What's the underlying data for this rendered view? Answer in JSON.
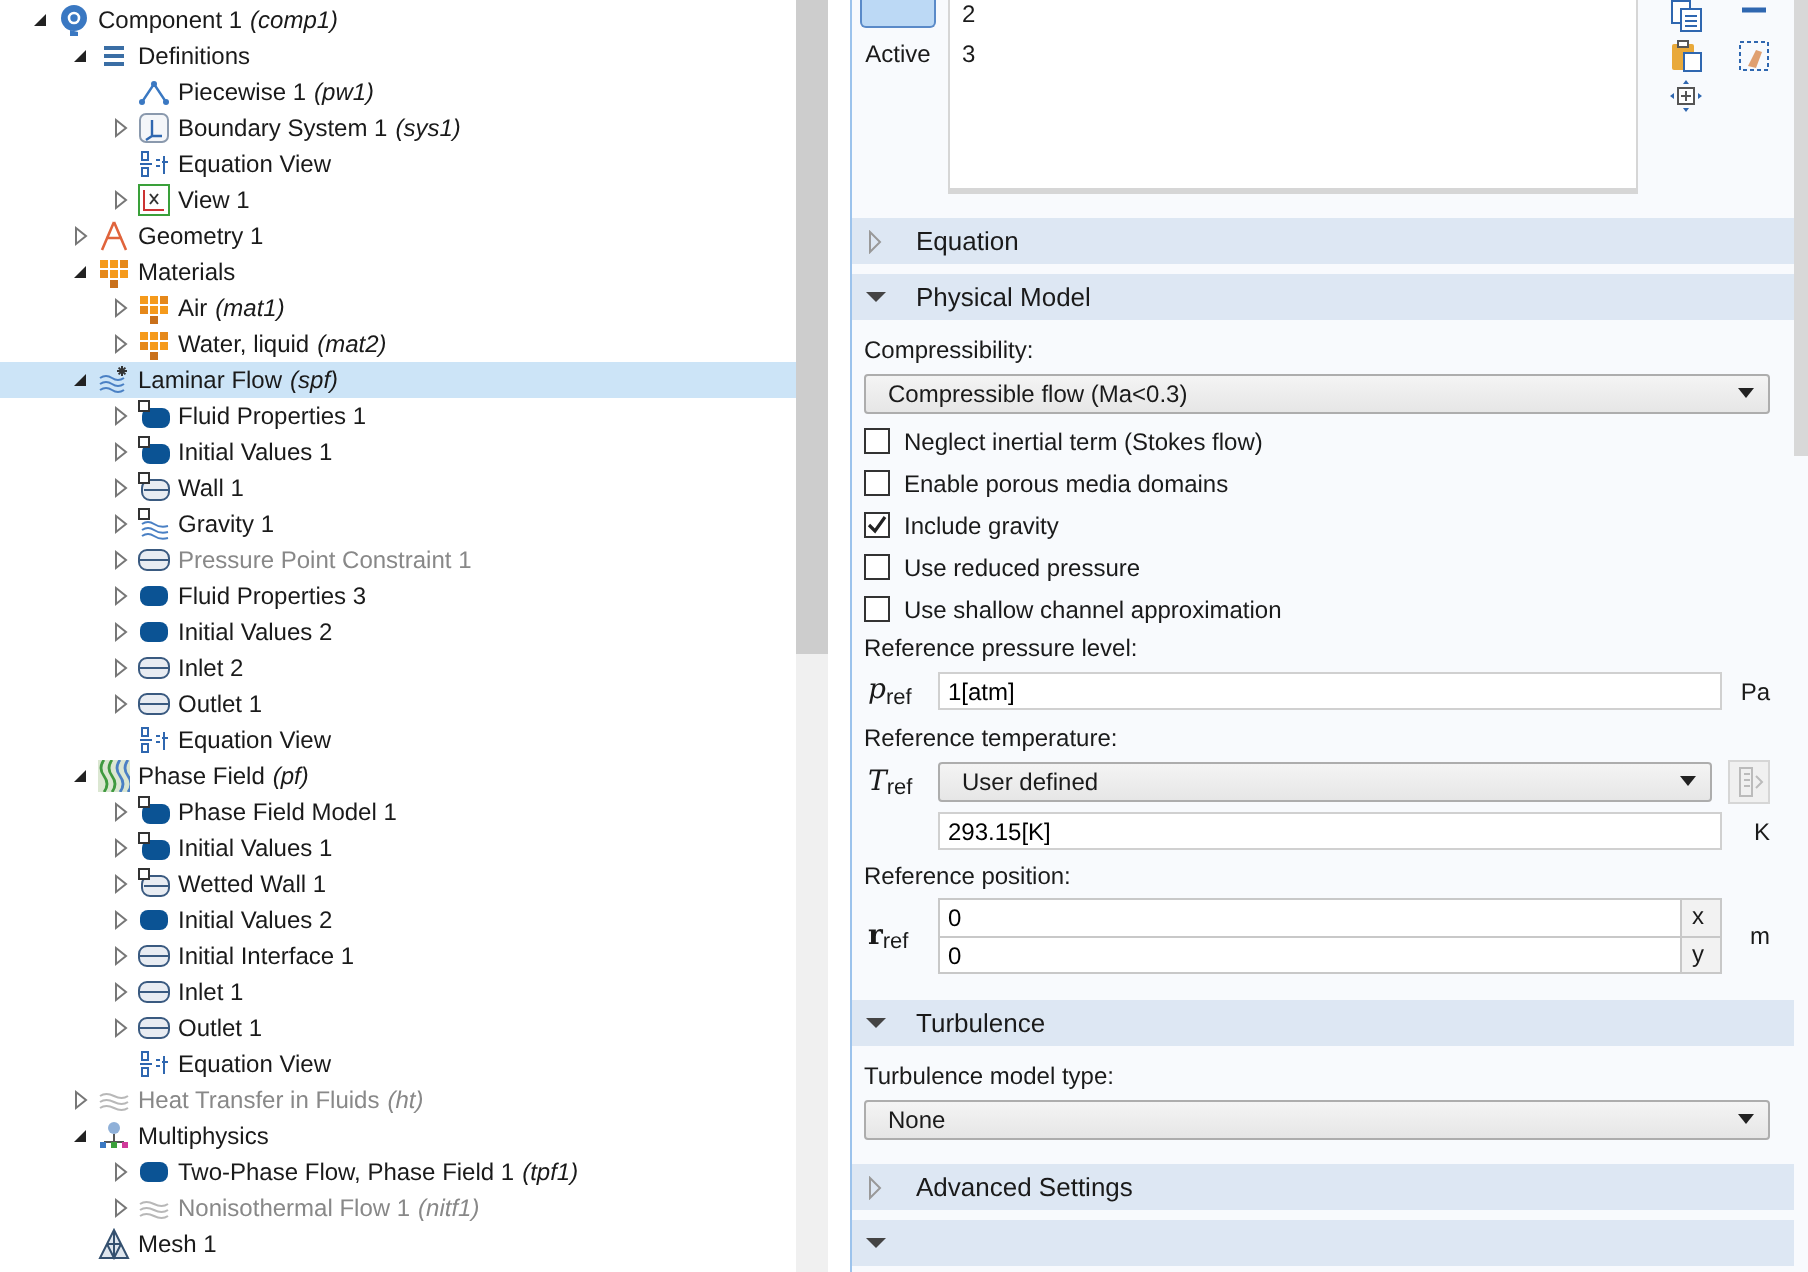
{
  "tree": [
    {
      "label": "Component 1",
      "tag": "(comp1)",
      "kind": "component",
      "expanded": true,
      "selected": false,
      "disabled": false,
      "children": [
        {
          "label": "Definitions",
          "kind": "list",
          "expanded": true,
          "selected": false,
          "disabled": false,
          "children": [
            {
              "label": "Piecewise 1",
              "tag": "(pw1)",
              "kind": "piecewise",
              "selected": false,
              "disabled": false
            },
            {
              "label": "Boundary System 1",
              "tag": "(sys1)",
              "kind": "coordsys",
              "expanded": false,
              "selected": false,
              "disabled": false
            },
            {
              "label": "Equation View",
              "kind": "equation",
              "selected": false,
              "disabled": false
            },
            {
              "label": "View 1",
              "kind": "view",
              "expanded": false,
              "selected": false,
              "disabled": false
            }
          ]
        },
        {
          "label": "Geometry 1",
          "kind": "geometry",
          "expanded": false,
          "selected": false,
          "disabled": false
        },
        {
          "label": "Materials",
          "kind": "materials",
          "expanded": true,
          "selected": false,
          "disabled": false,
          "children": [
            {
              "label": "Air",
              "tag": "(mat1)",
              "kind": "materials",
              "expanded": false,
              "selected": false,
              "disabled": false
            },
            {
              "label": "Water, liquid",
              "tag": "(mat2)",
              "kind": "materials",
              "expanded": false,
              "selected": false,
              "disabled": false
            }
          ]
        },
        {
          "label": "Laminar Flow",
          "tag": "(spf)",
          "kind": "flow",
          "expanded": true,
          "selected": true,
          "disabled": false,
          "children": [
            {
              "label": "Fluid Properties 1",
              "kind": "domain-default",
              "expanded": false,
              "selected": false,
              "disabled": false
            },
            {
              "label": "Initial Values 1",
              "kind": "domain-default",
              "expanded": false,
              "selected": false,
              "disabled": false
            },
            {
              "label": "Wall 1",
              "kind": "boundary-default",
              "expanded": false,
              "selected": false,
              "disabled": false
            },
            {
              "label": "Gravity 1",
              "kind": "gravity",
              "expanded": false,
              "selected": false,
              "disabled": false
            },
            {
              "label": "Pressure Point Constraint 1",
              "kind": "boundary",
              "expanded": false,
              "selected": false,
              "disabled": true
            },
            {
              "label": "Fluid Properties 3",
              "kind": "domain",
              "expanded": false,
              "selected": false,
              "disabled": false
            },
            {
              "label": "Initial Values 2",
              "kind": "domain",
              "expanded": false,
              "selected": false,
              "disabled": false
            },
            {
              "label": "Inlet 2",
              "kind": "boundary",
              "expanded": false,
              "selected": false,
              "disabled": false
            },
            {
              "label": "Outlet 1",
              "kind": "boundary",
              "expanded": false,
              "selected": false,
              "disabled": false
            },
            {
              "label": "Equation View",
              "kind": "equation",
              "selected": false,
              "disabled": false
            }
          ]
        },
        {
          "label": "Phase Field",
          "tag": "(pf)",
          "kind": "phase",
          "expanded": true,
          "selected": false,
          "disabled": false,
          "children": [
            {
              "label": "Phase Field Model 1",
              "kind": "domain-default",
              "expanded": false,
              "selected": false,
              "disabled": false
            },
            {
              "label": "Initial Values 1",
              "kind": "domain-default",
              "expanded": false,
              "selected": false,
              "disabled": false
            },
            {
              "label": "Wetted Wall 1",
              "kind": "boundary-default",
              "expanded": false,
              "selected": false,
              "disabled": false
            },
            {
              "label": "Initial Values 2",
              "kind": "domain",
              "expanded": false,
              "selected": false,
              "disabled": false
            },
            {
              "label": "Initial Interface 1",
              "kind": "boundary",
              "expanded": false,
              "selected": false,
              "disabled": false
            },
            {
              "label": "Inlet 1",
              "kind": "boundary",
              "expanded": false,
              "selected": false,
              "disabled": false
            },
            {
              "label": "Outlet 1",
              "kind": "boundary",
              "expanded": false,
              "selected": false,
              "disabled": false
            },
            {
              "label": "Equation View",
              "kind": "equation",
              "selected": false,
              "disabled": false
            }
          ]
        },
        {
          "label": "Heat Transfer in Fluids",
          "tag": "(ht)",
          "kind": "heat",
          "expanded": false,
          "selected": false,
          "disabled": true
        },
        {
          "label": "Multiphysics",
          "kind": "multiphysics",
          "expanded": true,
          "selected": false,
          "disabled": false,
          "children": [
            {
              "label": "Two-Phase Flow, Phase Field 1",
              "tag": "(tpf1)",
              "kind": "domain",
              "expanded": false,
              "selected": false,
              "disabled": false
            },
            {
              "label": "Nonisothermal Flow 1",
              "tag": "(nitf1)",
              "kind": "heat",
              "expanded": false,
              "selected": false,
              "disabled": true
            }
          ]
        },
        {
          "label": "Mesh 1",
          "kind": "mesh",
          "selected": false,
          "disabled": false
        }
      ]
    }
  ],
  "selection": {
    "button": "Active",
    "items": [
      "2",
      "3"
    ]
  },
  "sections": [
    {
      "title": "Equation",
      "expanded": false
    },
    {
      "title": "Physical Model",
      "expanded": true,
      "controls": [
        {
          "kind": "label",
          "text": "Compressibility:"
        },
        {
          "kind": "select",
          "value": "Compressible flow (Ma<0.3)"
        },
        {
          "kind": "checkbox",
          "label": "Neglect inertial term (Stokes flow)",
          "checked": false
        },
        {
          "kind": "checkbox",
          "label": "Enable porous media domains",
          "checked": false
        },
        {
          "kind": "checkbox",
          "label": "Include gravity",
          "checked": true
        },
        {
          "kind": "checkbox",
          "label": "Use reduced pressure",
          "checked": false
        },
        {
          "kind": "checkbox",
          "label": "Use shallow channel approximation",
          "checked": false
        },
        {
          "kind": "label",
          "text": "Reference pressure level:"
        },
        {
          "kind": "input",
          "symbol": "*p*$_{ref}$",
          "value": "1[atm]",
          "unit": "Pa"
        },
        {
          "kind": "label",
          "text": "Reference temperature:"
        },
        {
          "kind": "select",
          "symbol": "*T*$_{ref}$",
          "value": "User defined",
          "side_button": true
        },
        {
          "kind": "input",
          "value": "293.15[K]",
          "unit": "K"
        },
        {
          "kind": "label",
          "text": "Reference position:"
        },
        {
          "kind": "vector",
          "symbol": "**r**$_{ref}$",
          "unit": "m",
          "components": [
            {
              "value": "0",
              "axis": "x"
            },
            {
              "value": "0",
              "axis": "y"
            }
          ]
        }
      ]
    },
    {
      "title": "Turbulence",
      "expanded": true,
      "controls": [
        {
          "kind": "label",
          "text": "Turbulence model type:"
        },
        {
          "kind": "select",
          "value": "None"
        }
      ]
    },
    {
      "title": "Advanced Settings",
      "expanded": false
    },
    {
      "expanded": true
    }
  ]
}
